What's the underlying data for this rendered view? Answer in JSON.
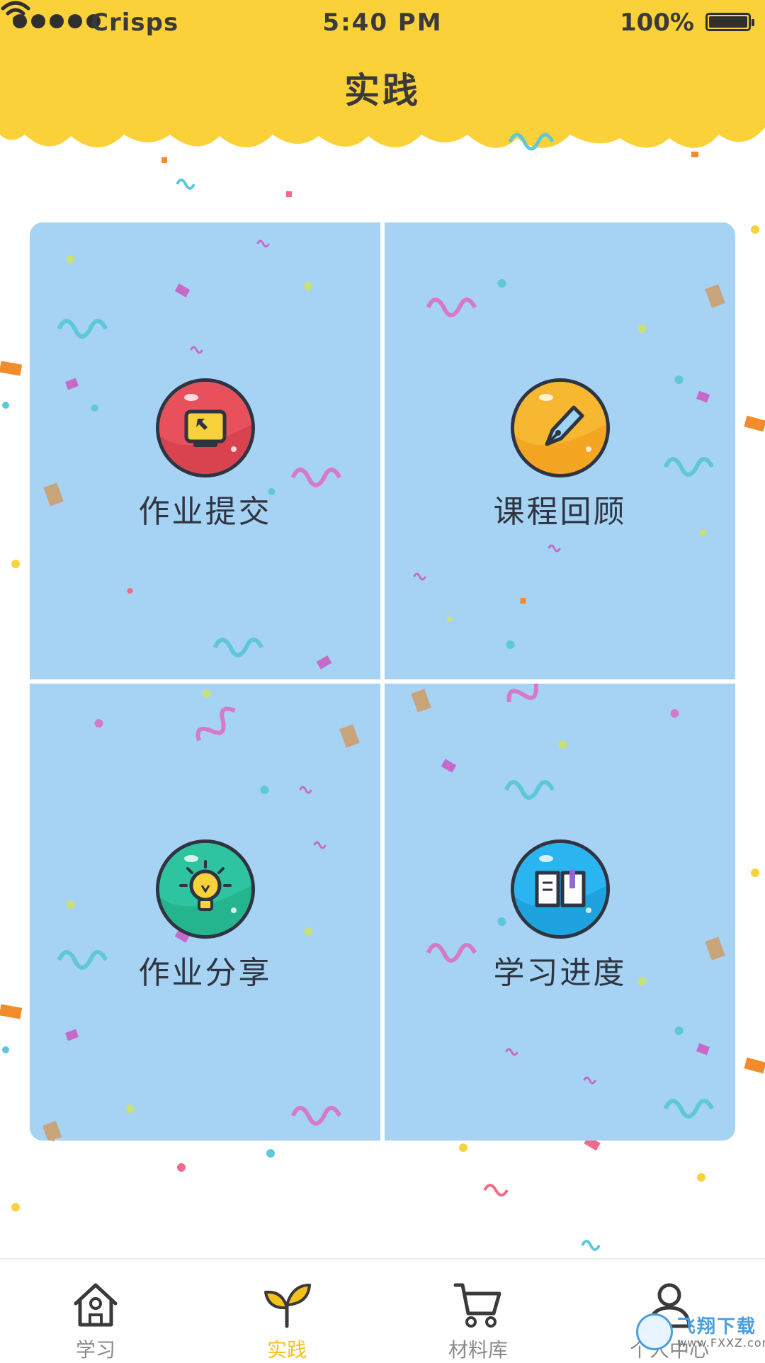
{
  "status_bar": {
    "carrier": "Crisps",
    "time": "5:40 PM",
    "battery": "100%"
  },
  "header": {
    "title": "实践"
  },
  "tiles": [
    {
      "label": "作业提交",
      "icon": "monitor-cursor-icon",
      "color": "#e8505b"
    },
    {
      "label": "课程回顾",
      "icon": "pen-nib-icon",
      "color": "#f7b731"
    },
    {
      "label": "作业分享",
      "icon": "lightbulb-icon",
      "color": "#2ec4a0"
    },
    {
      "label": "学习进度",
      "icon": "open-book-icon",
      "color": "#2bb5f0"
    }
  ],
  "tabbar": {
    "items": [
      {
        "label": "学习",
        "icon": "house-icon",
        "active": false
      },
      {
        "label": "实践",
        "icon": "sprout-icon",
        "active": true
      },
      {
        "label": "材料库",
        "icon": "cart-icon",
        "active": false
      },
      {
        "label": "个人中心",
        "icon": "person-icon",
        "active": false
      }
    ]
  },
  "watermark": {
    "text": "飞翔下载",
    "sub": "www.FXXZ.com"
  },
  "colors": {
    "header_yellow": "#fbd13a",
    "tile_blue": "#a6d2f4",
    "active_tab": "#f5c21b",
    "inactive_tab": "#8a8a8a"
  }
}
